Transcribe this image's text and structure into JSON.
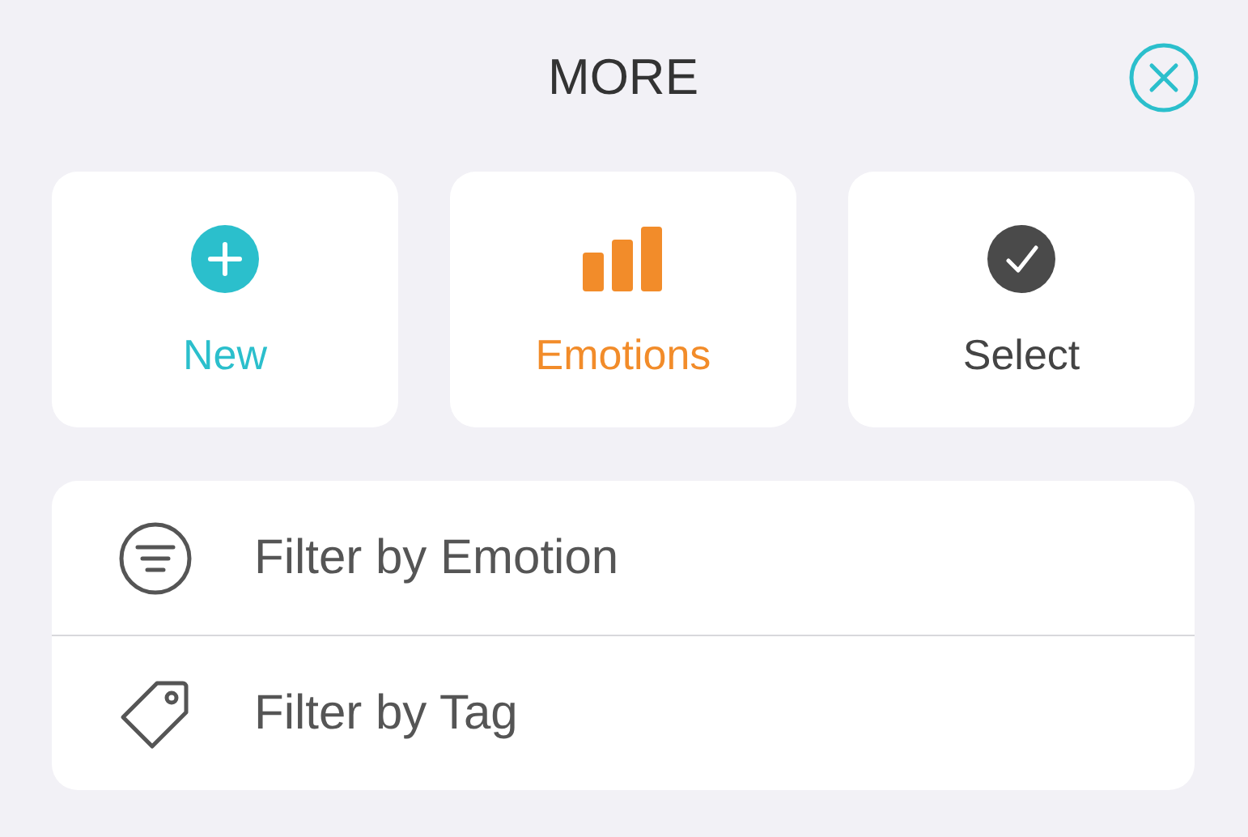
{
  "title": "MORE",
  "actions": [
    {
      "kind": "new",
      "label": "New",
      "color": "#2bbfcc"
    },
    {
      "kind": "emotions",
      "label": "Emotions",
      "color": "#f28c2a"
    },
    {
      "kind": "select",
      "label": "Select",
      "color": "#4a4a4a"
    }
  ],
  "filters": [
    {
      "kind": "emotion",
      "label": "Filter by Emotion"
    },
    {
      "kind": "tag",
      "label": "Filter by Tag"
    }
  ]
}
